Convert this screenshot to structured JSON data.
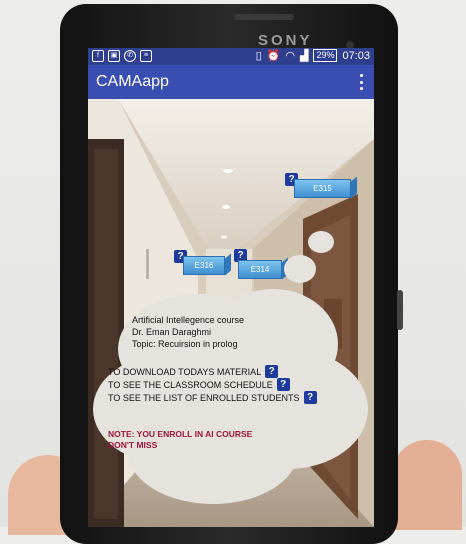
{
  "phone": {
    "brand": "SONY"
  },
  "statusbar": {
    "left_icons": [
      "facebook-icon",
      "image-icon",
      "whatsapp-icon",
      "file-icon"
    ],
    "right_icons": [
      "vibrate-icon",
      "alarm-icon",
      "wifi-icon",
      "signal-icon"
    ],
    "battery": "29%",
    "time": "07:03"
  },
  "appbar": {
    "title": "CAMAapp",
    "menu_icon": "more-vert-icon"
  },
  "ar_labels": [
    {
      "room": "E315",
      "help": "?"
    },
    {
      "room": "E316",
      "help": "?"
    },
    {
      "room": "E314",
      "help": "?"
    }
  ],
  "cloud": {
    "course": "Artificial Intellegence course",
    "instructor": "Dr. Eman Daraghmi",
    "topic": "Topic: Recuirsion in prolog",
    "options": [
      {
        "label": "TO DOWNLOAD TODAYS MATERIAL",
        "help": "?"
      },
      {
        "label": "TO SEE THE CLASSROOM SCHEDULE",
        "help": "?"
      },
      {
        "label": "TO SEE THE LIST OF ENROLLED STUDENTS",
        "help": "?"
      }
    ],
    "note_line1": "NOTE: YOU ENROLL IN AI COURSE",
    "note_line2": "DON'T MISS"
  },
  "colors": {
    "appbar": "#3a4db1",
    "statusbar": "#2f3f8f",
    "note": "#a0163a",
    "label": "#3d8fd1"
  }
}
